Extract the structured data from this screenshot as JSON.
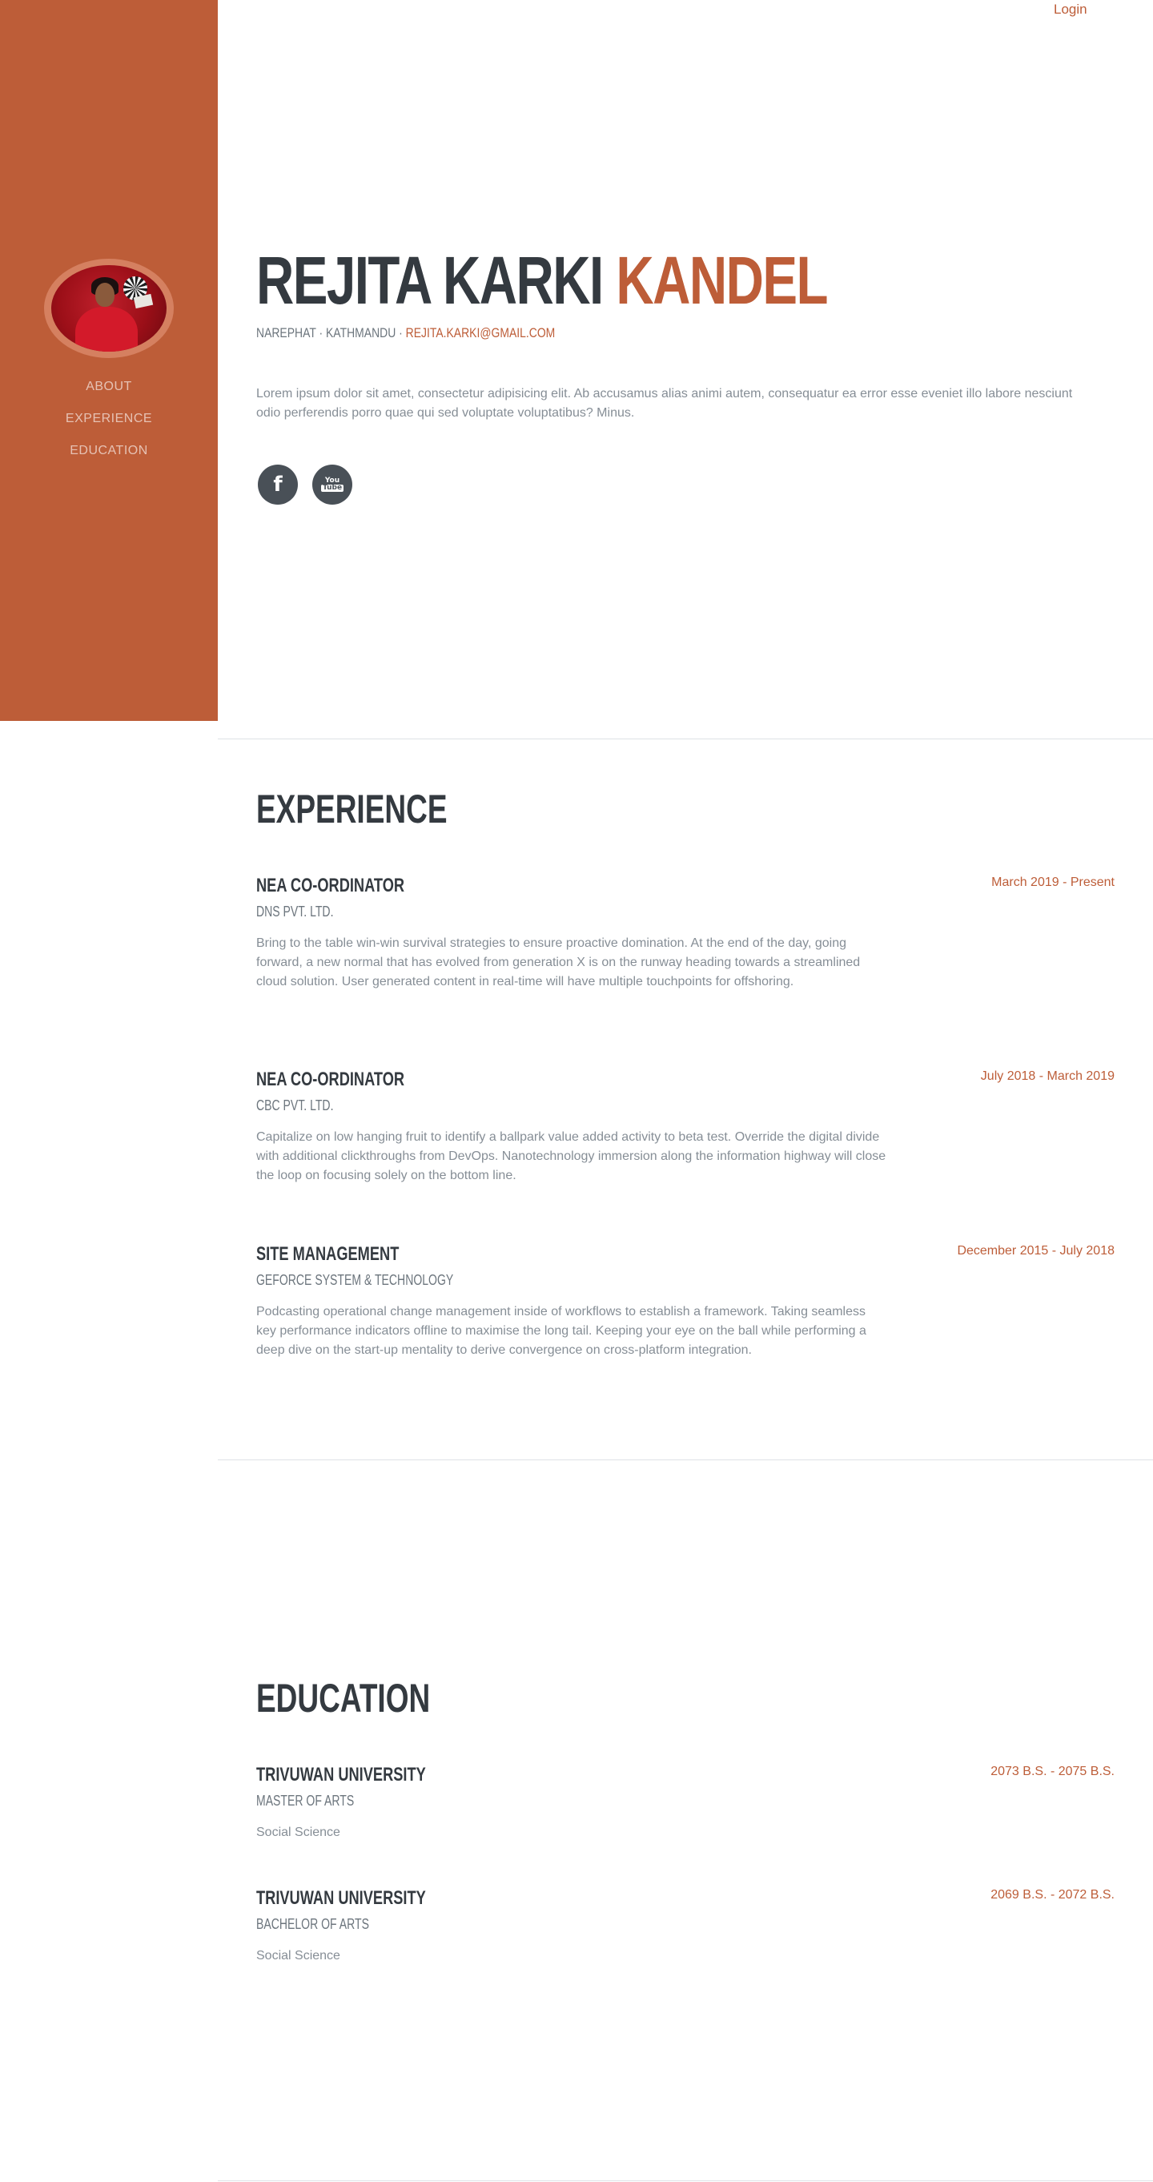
{
  "header": {
    "login_label": "Login"
  },
  "sidebar": {
    "nav": [
      "ABOUT",
      "EXPERIENCE",
      "EDUCATION"
    ]
  },
  "about": {
    "first_name": "REJITA KARKI",
    "last_name": "KANDEL",
    "location": "NAREPHAT · KATHMANDU · ",
    "email": "REJITA.KARKI@GMAIL.COM",
    "lead": "Lorem ipsum dolor sit amet, consectetur adipisicing elit. Ab accusamus alias animi autem, consequatur ea error esse eveniet illo labore nesciunt odio perferendis porro quae qui sed voluptate voluptatibus? Minus.",
    "social": [
      {
        "icon": "facebook-icon",
        "glyph": "f"
      },
      {
        "icon": "youtube-icon",
        "glyph_top": "You",
        "glyph_bottom": "Tube"
      }
    ]
  },
  "experience": {
    "title": "EXPERIENCE",
    "items": [
      {
        "role": "NEA CO-ORDINATOR",
        "org": "DNS PVT. LTD.",
        "desc": "Bring to the table win-win survival strategies to ensure proactive domination. At the end of the day, going forward, a new normal that has evolved from generation X is on the runway heading towards a streamlined cloud solution. User generated content in real-time will have multiple touchpoints for offshoring.",
        "date": "March 2019 - Present"
      },
      {
        "role": "NEA CO-ORDINATOR",
        "org": "CBC PVT. LTD.",
        "desc": "Capitalize on low hanging fruit to identify a ballpark value added activity to beta test. Override the digital divide with additional clickthroughs from DevOps. Nanotechnology immersion along the information highway will close the loop on focusing solely on the bottom line.",
        "date": "July 2018 - March 2019"
      },
      {
        "role": "SITE MANAGEMENT",
        "org": "GEFORCE SYSTEM & TECHNOLOGY",
        "desc": "Podcasting operational change management inside of workflows to establish a framework. Taking seamless key performance indicators offline to maximise the long tail. Keeping your eye on the ball while performing a deep dive on the start-up mentality to derive convergence on cross-platform integration.",
        "date": "December 2015 - July 2018"
      }
    ]
  },
  "education": {
    "title": "EDUCATION",
    "items": [
      {
        "school": "TRIVUWAN UNIVERSITY",
        "degree": "MASTER OF ARTS",
        "field": "Social Science",
        "date": "2073 B.S. - 2075 B.S."
      },
      {
        "school": "TRIVUWAN UNIVERSITY",
        "degree": "BACHELOR OF ARTS",
        "field": "Social Science",
        "date": "2069 B.S. - 2072 B.S."
      }
    ]
  },
  "colors": {
    "primary": "#bd5d38",
    "heading": "#343a40",
    "muted": "#868e96",
    "social_bg": "#495057"
  }
}
